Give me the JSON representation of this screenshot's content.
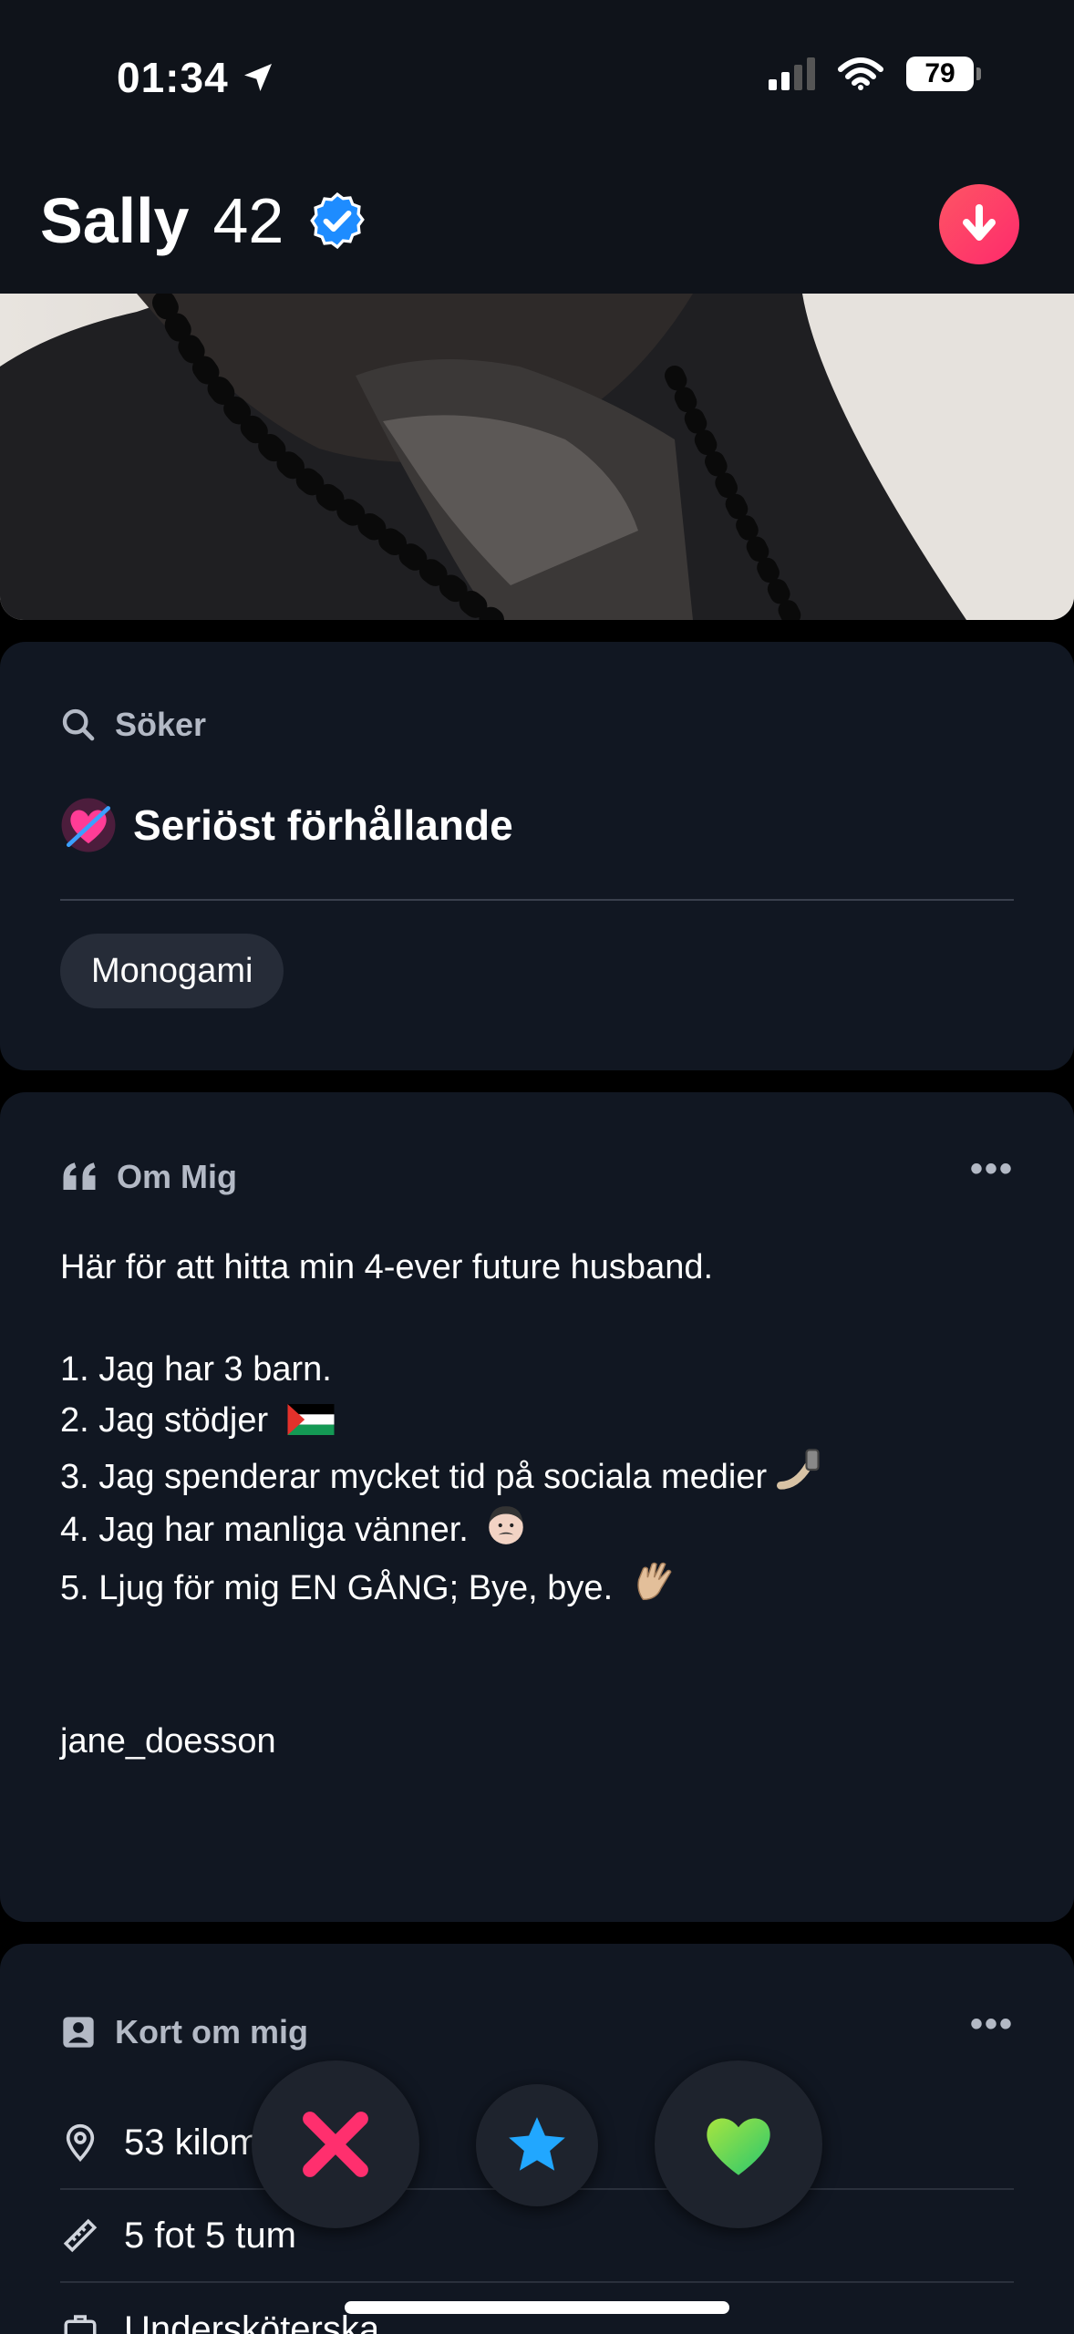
{
  "status_bar": {
    "time": "01:34",
    "battery": "79"
  },
  "profile": {
    "name": "Sally",
    "age": "42"
  },
  "looking_for": {
    "label": "Söker",
    "value": "Seriöst förhållande",
    "chips": [
      "Monogami"
    ]
  },
  "about": {
    "label": "Om Mig",
    "lines": [
      "Här för att hitta min 4-ever future husband.",
      "",
      "1. Jag har 3 barn.",
      "2. Jag stödjer",
      "3. Jag spenderar mycket tid på sociala medier",
      "4. Jag har manliga vänner.",
      "5. Ljug för mig EN GÅNG; Bye, bye.",
      "",
      "",
      "jane_doesson"
    ]
  },
  "essentials": {
    "label": "Kort om mig",
    "rows": [
      {
        "icon": "location-pin-icon",
        "text": "53 kilometer bort"
      },
      {
        "icon": "ruler-icon",
        "text": "5 fot 5 tum"
      },
      {
        "icon": "briefcase-icon",
        "text": "Undersköterska"
      }
    ]
  },
  "colors": {
    "accent": "#fd5564",
    "verified": "#1e8cff",
    "card": "#111722"
  }
}
